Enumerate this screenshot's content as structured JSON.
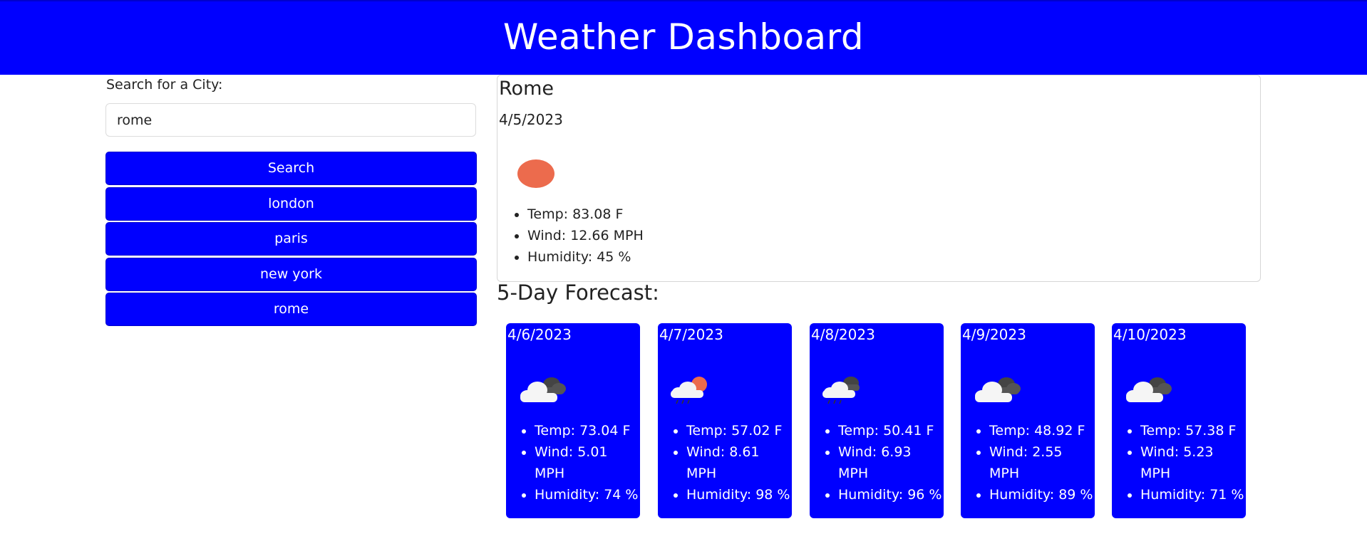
{
  "header": {
    "title": "Weather Dashboard"
  },
  "search": {
    "label": "Search for a City:",
    "value": "rome",
    "button_label": "Search",
    "history": [
      "london",
      "paris",
      "new york",
      "rome"
    ]
  },
  "current": {
    "city": "Rome",
    "date": "4/5/2023",
    "icon": "sun-icon",
    "temp": "Temp: 83.08 F",
    "wind": "Wind: 12.66 MPH",
    "humidity": "Humidity: 45 %"
  },
  "forecast": {
    "title": "5-Day Forecast:",
    "days": [
      {
        "date": "4/6/2023",
        "icon": "broken-clouds-icon",
        "temp": "Temp: 73.04 F",
        "wind": "Wind: 5.01 MPH",
        "humidity": "Humidity: 74 %"
      },
      {
        "date": "4/7/2023",
        "icon": "sun-rain-icon",
        "temp": "Temp: 57.02 F",
        "wind": "Wind: 8.61 MPH",
        "humidity": "Humidity: 98 %"
      },
      {
        "date": "4/8/2023",
        "icon": "rain-clouds-icon",
        "temp": "Temp: 50.41 F",
        "wind": "Wind: 6.93 MPH",
        "humidity": "Humidity: 96 %"
      },
      {
        "date": "4/9/2023",
        "icon": "broken-clouds-icon",
        "temp": "Temp: 48.92 F",
        "wind": "Wind: 2.55 MPH",
        "humidity": "Humidity: 89 %"
      },
      {
        "date": "4/10/2023",
        "icon": "broken-clouds-icon",
        "temp": "Temp: 57.38 F",
        "wind": "Wind: 5.23 MPH",
        "humidity": "Humidity: 71 %"
      }
    ]
  },
  "colors": {
    "primary": "#0000ff",
    "sun": "#ec6b4d",
    "cloud_dark": "#555555",
    "cloud_light": "#f5f5f5"
  }
}
